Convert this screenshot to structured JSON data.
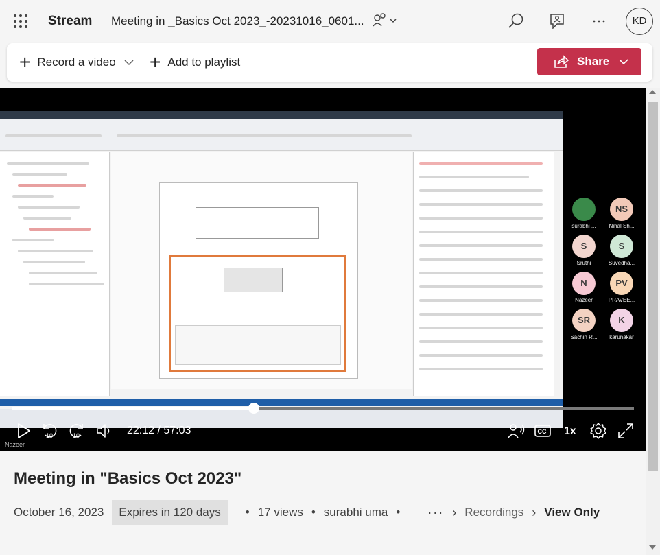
{
  "app": {
    "name": "Stream",
    "doc_title": "Meeting in _Basics Oct 2023_-20231016_0601...",
    "user_initials": "KD"
  },
  "topbar_icons": [
    "waffle-icon",
    "people-icon",
    "search-icon",
    "feedback-icon",
    "more-icon"
  ],
  "commands": {
    "record_label": "Record a video",
    "playlist_label": "Add to playlist",
    "share_label": "Share"
  },
  "colors": {
    "share": "#c4314b",
    "accent_progress": "#ffffff",
    "video_bg": "#000000"
  },
  "player": {
    "current_time": "22:12",
    "duration": "57:03",
    "time_display": "22:12 / 57:03",
    "progress": 0.389,
    "speed": "1x",
    "presenter_tag": "Nazeer"
  },
  "participants": [
    {
      "initials": "",
      "name": "surabhi ...",
      "color": "#3a8a4a"
    },
    {
      "initials": "NS",
      "name": "Nihal Sh...",
      "color": "#f2c9b8"
    },
    {
      "initials": "S",
      "name": "Sruthi",
      "color": "#f3d6cf"
    },
    {
      "initials": "S",
      "name": "Suvedha...",
      "color": "#cfe8d6"
    },
    {
      "initials": "N",
      "name": "Nazeer",
      "color": "#f7c9d4"
    },
    {
      "initials": "PV",
      "name": "PRAVEE...",
      "color": "#f9d7b6"
    },
    {
      "initials": "SR",
      "name": "Sachin R...",
      "color": "#f3d2c2"
    },
    {
      "initials": "K",
      "name": "karunakar",
      "color": "#f2d3e6"
    }
  ],
  "details": {
    "title": "Meeting in \"Basics Oct 2023\"",
    "date": "October 16, 2023",
    "expires": "Expires in 120 days",
    "views": "17 views",
    "owner": "surabhi uma",
    "crumb_more": "···",
    "crumb_folder": "Recordings",
    "crumb_current": "View Only"
  }
}
